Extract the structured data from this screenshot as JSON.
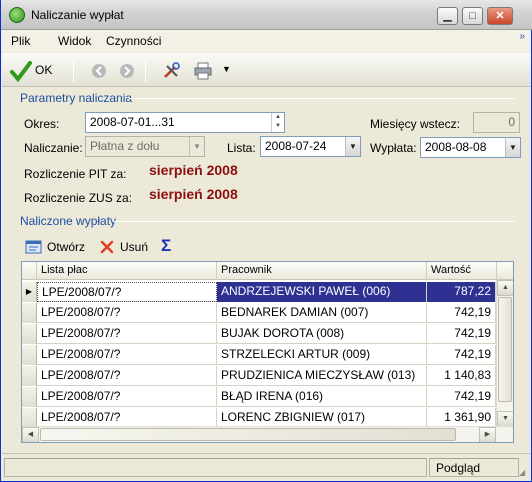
{
  "window": {
    "title": "Naliczanie wypłat"
  },
  "menu": {
    "items": [
      "Plik",
      "Widok",
      "Czynności"
    ],
    "more": "»"
  },
  "toolbar": {
    "ok_label": "OK"
  },
  "params": {
    "section_title": "Parametry naliczania",
    "okres_label": "Okres:",
    "okres_value": "2008-07-01...31",
    "miesiecy_label": "Miesięcy wstecz:",
    "miesiecy_value": "0",
    "naliczanie_label": "Naliczanie:",
    "naliczanie_value": "Płatna z dołu",
    "lista_label": "Lista:",
    "lista_value": "2008-07-24",
    "wyplata_label": "Wypłata:",
    "wyplata_value": "2008-08-08",
    "pit_label": "Rozliczenie PIT za:",
    "pit_value": "sierpień 2008",
    "zus_label": "Rozliczenie ZUS za:",
    "zus_value": "sierpień 2008"
  },
  "payouts": {
    "section_title": "Naliczone wypłaty",
    "open_label": "Otwórz",
    "delete_label": "Usuń",
    "columns": [
      "Lista płac",
      "Pracownik",
      "Wartość"
    ],
    "rows": [
      {
        "list": "LPE/2008/07/?",
        "employee": "ANDRZEJEWSKI PAWEŁ (006)",
        "value": "787,22"
      },
      {
        "list": "LPE/2008/07/?",
        "employee": "BEDNAREK DAMIAN (007)",
        "value": "742,19"
      },
      {
        "list": "LPE/2008/07/?",
        "employee": "BUJAK DOROTA (008)",
        "value": "742,19"
      },
      {
        "list": "LPE/2008/07/?",
        "employee": "STRZELECKI ARTUR (009)",
        "value": "742,19"
      },
      {
        "list": "LPE/2008/07/?",
        "employee": "PRUDZIENICA MIECZYSŁAW (013)",
        "value": "1 140,83"
      },
      {
        "list": "LPE/2008/07/?",
        "employee": "BŁĄD IRENA (016)",
        "value": "742,19"
      },
      {
        "list": "LPE/2008/07/?",
        "employee": "LORENC ZBIGNIEW (017)",
        "value": "1 361,90"
      }
    ]
  },
  "status": {
    "panel": "Podgląd"
  }
}
